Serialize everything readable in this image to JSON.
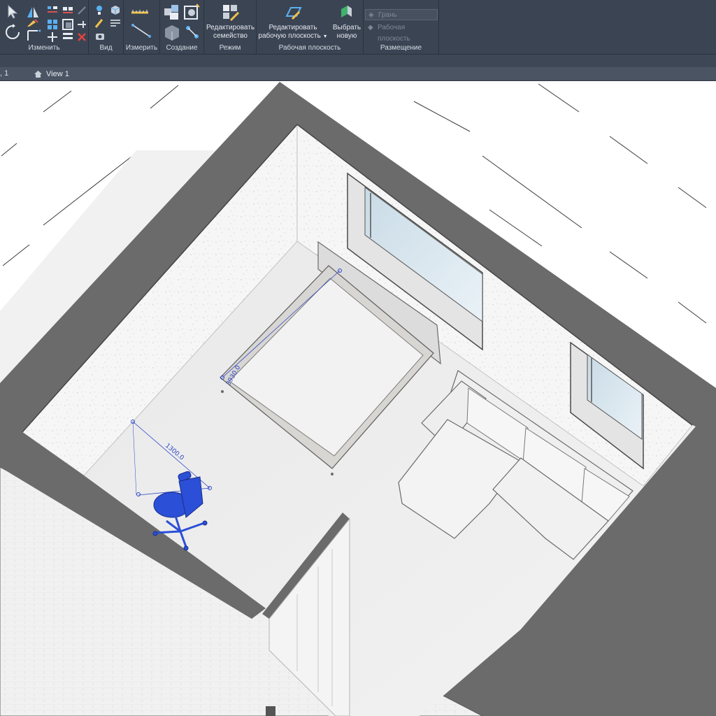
{
  "ribbon": {
    "panels": {
      "modify": "Изменить",
      "view": "Вид",
      "measure": "Измерить",
      "create": "Создание",
      "mode": "Режим",
      "workplane": "Рабочая плоскость",
      "placement": "Размещение"
    },
    "mode": {
      "edit_family": [
        "Редактировать",
        "семейство"
      ]
    },
    "workplane": {
      "edit_workplane": [
        "Редактировать",
        "рабочую плоскость"
      ],
      "pick_new": [
        "Выбрать",
        "новую"
      ]
    },
    "placement": {
      "face": "Грань",
      "workplane": "Рабочая плоскость"
    }
  },
  "tabs": {
    "prev_tab": ", 1",
    "active_tab": "View 1"
  },
  "dimensions": {
    "bed_length": "3930.0",
    "chair_offset": "1300.0"
  },
  "colors": {
    "ribbon_bg": "#3b4453",
    "selection": "#2b4fd6",
    "wall_cut": "#6b6b6b"
  }
}
